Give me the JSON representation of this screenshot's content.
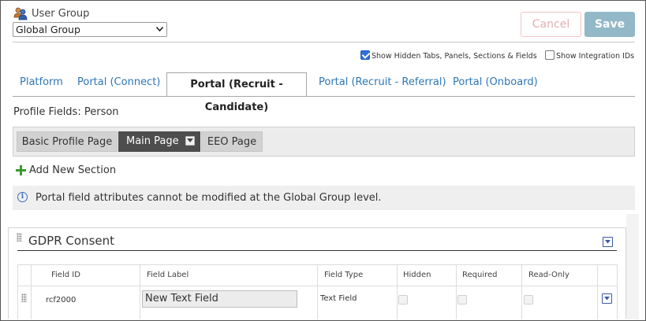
{
  "header": {
    "user_group_label": "User Group",
    "group_select_value": "Global Group",
    "cancel_label": "Cancel",
    "save_label": "Save",
    "user_group_icon": "user-group-icon"
  },
  "options": {
    "show_hidden_label": "Show Hidden Tabs, Panels, Sections & Fields",
    "show_hidden_checked": true,
    "show_integration_label": "Show Integration IDs",
    "show_integration_checked": false
  },
  "tabs": [
    {
      "label": "Platform",
      "active": false
    },
    {
      "label": "Portal (Connect)",
      "active": false
    },
    {
      "label": "Portal (Recruit - Candidate)",
      "active": true
    },
    {
      "label": "Portal (Recruit - Referral)",
      "active": false
    },
    {
      "label": "Portal (Onboard)",
      "active": false
    }
  ],
  "profile_fields_label": "Profile Fields: Person",
  "page_tabs": [
    {
      "label": "Basic Profile Page",
      "active": false
    },
    {
      "label": "Main Page",
      "active": true
    },
    {
      "label": "EEO Page",
      "active": false
    }
  ],
  "add_section_label": "Add New Section",
  "info_message": "Portal field attributes cannot be modified at the Global Group level.",
  "section": {
    "title": "GDPR Consent",
    "columns": [
      "Field ID",
      "Field Label",
      "Field Type",
      "Hidden",
      "Required",
      "Read-Only"
    ],
    "rows": [
      {
        "field_id": "rcf2000",
        "field_label": "New Text Field",
        "field_type": "Text Field",
        "hidden": false,
        "required": false,
        "read_only": false
      }
    ]
  },
  "colors": {
    "accent_link": "#2d77b5",
    "save_button": "#93b8c8",
    "cancel_text": "#e4aeb0",
    "active_subtab": "#4d4d4d",
    "plus_icon": "#3b9b2e"
  }
}
